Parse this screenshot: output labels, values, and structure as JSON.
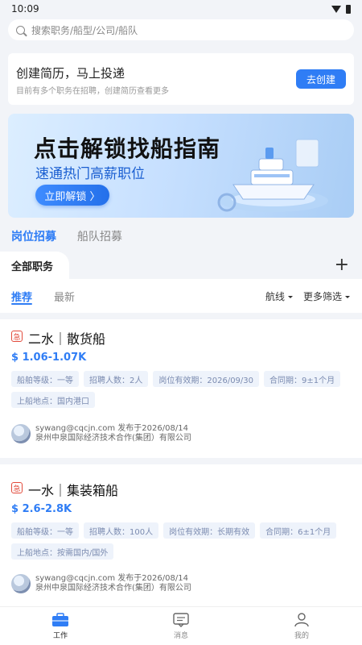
{
  "status": {
    "time": "10:09"
  },
  "search": {
    "placeholder": "搜索职务/船型/公司/船队"
  },
  "resume": {
    "title": "创建简历，马上投递",
    "subtitle": "目前有多个职务在招聘，创建简历查看更多",
    "button": "去创建"
  },
  "banner": {
    "title": "点击解锁找船指南",
    "subtitle": "速通热门高薪职位",
    "button": "立即解锁 〉"
  },
  "main_tabs": [
    "岗位招募",
    "船队招募"
  ],
  "subbar": {
    "tab": "全部职务",
    "plus": "+"
  },
  "filters": {
    "tabs": [
      "推荐",
      "最新"
    ],
    "route": "航线",
    "more": "更多筛选"
  },
  "jobs": [
    {
      "urgent": "急",
      "title": "二水｜散货船",
      "salary": "$ 1.06-1.07K",
      "tags": [
        "船舶等级：一等",
        "招聘人数：2人",
        "岗位有效期：2026/09/30",
        "合同期：9±1个月",
        "上船地点：国内港口"
      ],
      "poster": "sywang@cqcjn.com 发布于2026/08/14",
      "company": "泉州中泉国际经济技术合作(集团）有限公司"
    },
    {
      "urgent": "急",
      "title": "一水｜集装箱船",
      "salary": "$ 2.6-2.8K",
      "tags": [
        "船舶等级：一等",
        "招聘人数：100人",
        "岗位有效期：长期有效",
        "合同期：6±1个月",
        "上船地点：按需国内/国外"
      ],
      "poster": "sywang@cqcjn.com 发布于2026/08/14",
      "company": "泉州中泉国际经济技术合作(集团）有限公司"
    }
  ],
  "nav": [
    "工作",
    "消息",
    "我的"
  ],
  "colors": {
    "accent": "#2f7df5",
    "urgent": "#e24a3b"
  }
}
